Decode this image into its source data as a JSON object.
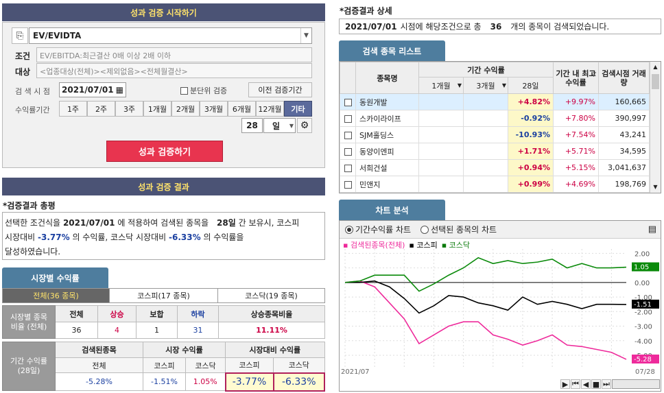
{
  "left": {
    "start_title": "성과 검증 시작하기",
    "strategy_value": "EV/EVIDTA",
    "cond_label": "조건",
    "cond_text": "EV/EBITDA:최근결산 0배 이상 2배 이하",
    "target_label": "대상",
    "target_text": "<업종대상(전체)><제외없음><전체월결산>",
    "date_label": "검 색 시 점",
    "date_value": "2021/07/01",
    "minute_label": "분단위 검증",
    "prev_btn": "이전 검증기간",
    "period_label": "수익률기간",
    "periods": [
      "1주",
      "2주",
      "3주",
      "1개월",
      "2개월",
      "3개월",
      "6개월",
      "12개월",
      "기타"
    ],
    "days_value": "28",
    "days_unit": "일",
    "run_btn": "성과 검증하기",
    "result_title": "성과 검증 결과",
    "summary_title": "*검증결과 총평",
    "summary": {
      "p1": "선택한 조건식을",
      "date": "2021/07/01",
      "p2": "에 적용하여 검색된 종목을",
      "days": "28일",
      "p3": "간 보유시, 코스피",
      "p4": "시장대비",
      "v1": "-3.77%",
      "p5": "의 수익률, 코스닥 시장대비",
      "v2": "-6.33%",
      "p6": "의 수익률을",
      "p7": "달성하였습니다."
    },
    "market_tab": "시장별 수익률",
    "subtabs": [
      "전체(36 종목)",
      "코스피(17 종목)",
      "코스닥(19 종목)"
    ],
    "ratio_label": "시장별 종목비율 (전체)",
    "ratio_headers": [
      "전체",
      "상승",
      "보합",
      "하락",
      "상승종목비율"
    ],
    "ratio_values": [
      "36",
      "4",
      "1",
      "31",
      "11.11%"
    ],
    "ret_label": "기간 수익률 (28일)",
    "ret_groups": [
      "검색된종목",
      "시장 수익률",
      "시장대비 수익률"
    ],
    "ret_sub": [
      "전체",
      "코스피",
      "코스닥",
      "코스피",
      "코스닥"
    ],
    "ret_values": [
      "-5.28%",
      "-1.51%",
      "1.05%",
      "-3.77%",
      "-6.33%"
    ]
  },
  "right": {
    "detail_title": "*검증결과 상세",
    "detail": {
      "date": "2021/07/01",
      "t1": "시점에 해당조건으로 총",
      "count": "36",
      "t2": "개의 종목이 검색되었습니다."
    },
    "list_tab": "검색 종목 리스트",
    "headers": {
      "name": "종목명",
      "period": "기간 수익률",
      "sel1": "1개월",
      "sel2": "3개월",
      "d28": "28일",
      "max": "기간 내 최고수익률",
      "vol": "검색시점 거래량"
    },
    "rows": [
      {
        "name": "동원개발",
        "r28": "+4.82%",
        "max": "+9.97%",
        "vol": "160,665"
      },
      {
        "name": "스카이라이프",
        "r28": "-0.92%",
        "max": "+7.80%",
        "vol": "390,997"
      },
      {
        "name": "SJM홀딩스",
        "r28": "-10.93%",
        "max": "+7.54%",
        "vol": "43,241"
      },
      {
        "name": "동양이엔피",
        "r28": "+1.71%",
        "max": "+5.71%",
        "vol": "34,595"
      },
      {
        "name": "서희건설",
        "r28": "+0.94%",
        "max": "+5.15%",
        "vol": "3,041,637"
      },
      {
        "name": "민앤지",
        "r28": "+0.99%",
        "max": "+4.69%",
        "vol": "198,769"
      }
    ],
    "chart_tab": "차트 분석",
    "radio1": "기간수익률 차트",
    "radio2": "선택된 종목의 차트",
    "legend": [
      "검색된종목(전체)",
      "코스피",
      "코스닥"
    ],
    "x_start": "2021/07",
    "x_end": "07/28"
  },
  "chart_data": {
    "type": "line",
    "x": [
      1,
      2,
      3,
      4,
      5,
      6,
      7,
      8,
      9,
      10,
      11,
      12,
      13,
      14,
      15,
      16,
      17,
      18,
      19,
      20
    ],
    "series": [
      {
        "name": "검색된종목(전체)",
        "color": "#ee2a9b",
        "values": [
          0,
          0.1,
          -0.3,
          -1.4,
          -2.5,
          -4.2,
          -3.6,
          -3.0,
          -2.7,
          -2.7,
          -3.6,
          -3.9,
          -4.3,
          -4.0,
          -3.6,
          -4.3,
          -4.4,
          -4.6,
          -4.8,
          -5.28
        ]
      },
      {
        "name": "코스피",
        "color": "#000000",
        "values": [
          0,
          0,
          0.1,
          -0.3,
          -1.1,
          -2.1,
          -1.6,
          -0.9,
          -1.0,
          -1.4,
          -1.6,
          -1.9,
          -1.0,
          -1.5,
          -1.3,
          -1.5,
          -1.8,
          -1.5,
          -1.5,
          -1.51
        ]
      },
      {
        "name": "코스닥",
        "color": "#0a8a0a",
        "values": [
          0,
          0.1,
          0.5,
          0.5,
          0.5,
          -0.6,
          -0.1,
          0.5,
          1.0,
          1.7,
          1.3,
          1.5,
          1.3,
          1.4,
          1.6,
          1.0,
          1.3,
          1.0,
          1.0,
          1.05
        ]
      }
    ],
    "yticks": [
      "2.00",
      "1.00",
      "0.00",
      "-1.00",
      "-2.00",
      "-3.00",
      "-4.00",
      "-5.00"
    ],
    "ylim": [
      -5.8,
      2.3
    ],
    "end_labels": [
      "1.05",
      "-1.51",
      "-5.28"
    ]
  }
}
